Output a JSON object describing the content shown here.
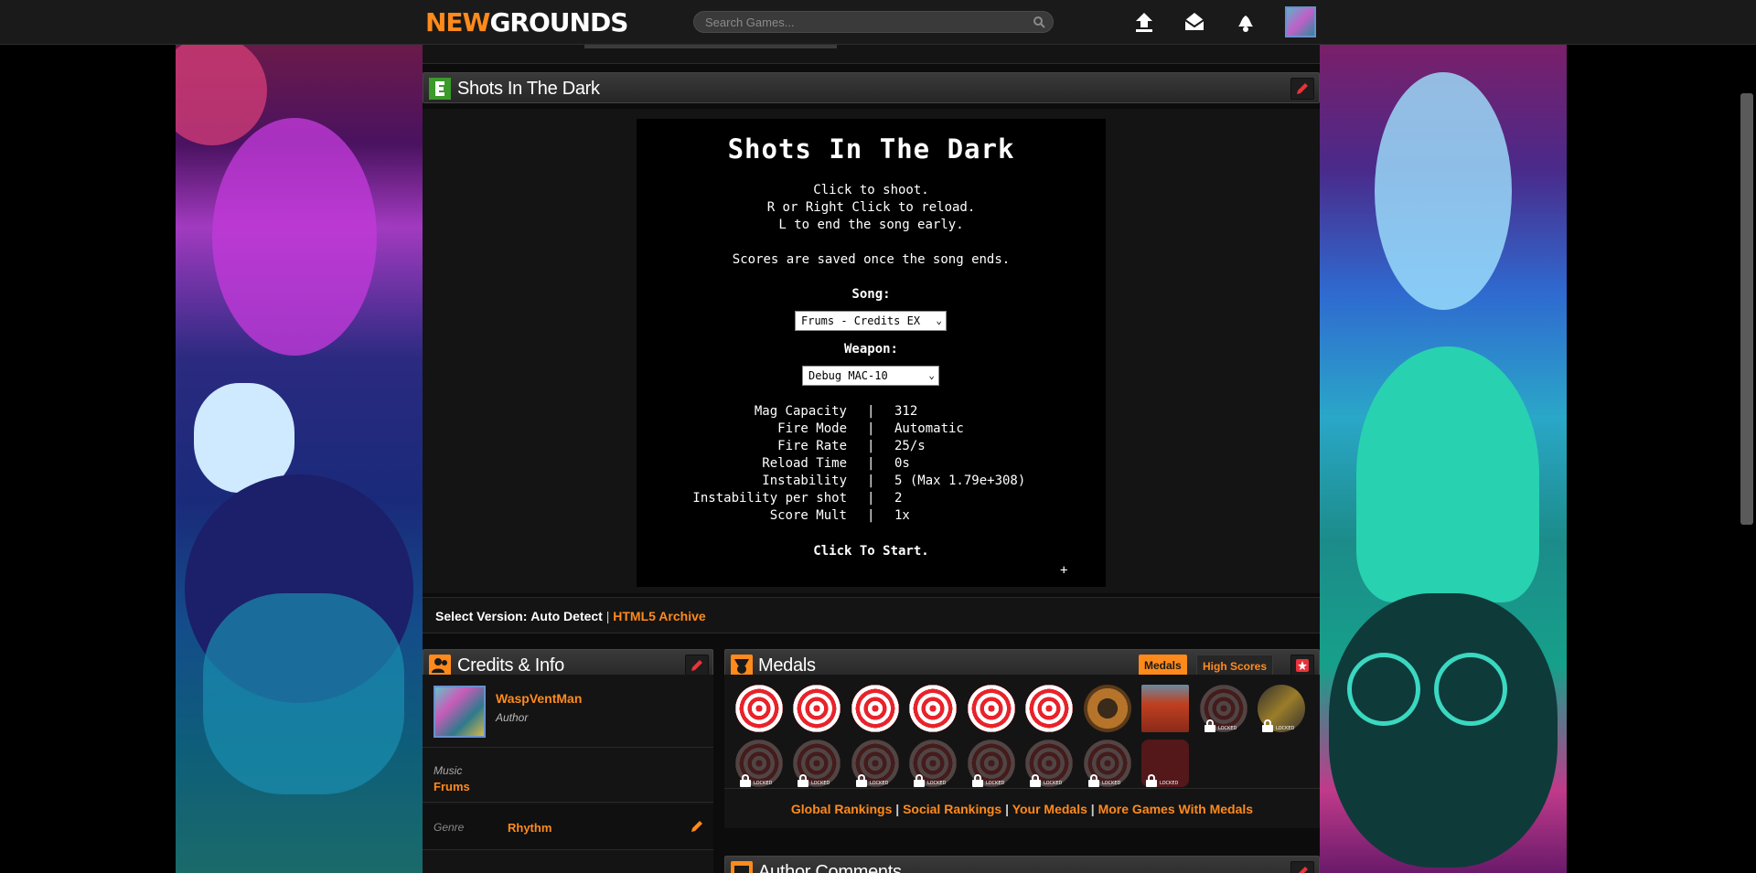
{
  "header": {
    "logo_new": "NEW",
    "logo_grounds": "GROUNDS",
    "search_placeholder": "Search Games..."
  },
  "game_panel": {
    "title": "Shots In The Dark"
  },
  "game": {
    "title": "Shots In The Dark",
    "instructions": [
      "Click to shoot.",
      "R or Right Click to reload.",
      "L to end the song early."
    ],
    "save_note": "Scores are saved once the song ends.",
    "song_label": "Song:",
    "song_value": "Frums - Credits EX",
    "weapon_label": "Weapon:",
    "weapon_value": "Debug MAC-10",
    "stats": [
      {
        "label": "Mag Capacity",
        "sep": "|",
        "value": "312"
      },
      {
        "label": "Fire Mode",
        "sep": "|",
        "value": "Automatic"
      },
      {
        "label": "Fire Rate",
        "sep": "|",
        "value": "25/s"
      },
      {
        "label": "Reload Time",
        "sep": "|",
        "value": "0s"
      },
      {
        "label": "Instability",
        "sep": "|",
        "value": "5 (Max 1.79e+308)"
      },
      {
        "label": "Instability per shot",
        "sep": "|",
        "value": "2"
      },
      {
        "label": "Score Mult",
        "sep": "|",
        "value": "1x"
      }
    ],
    "start": "Click To Start.",
    "crosshair": "+"
  },
  "version": {
    "label": "Select Version:",
    "current": "Auto Detect",
    "sep": "|",
    "archive": "HTML5 Archive"
  },
  "credits": {
    "title": "Credits & Info",
    "author_name": "WaspVentMan",
    "author_role": "Author",
    "music_label": "Music",
    "music_value": "Frums",
    "genre_label": "Genre",
    "genre_value": "Rhythm"
  },
  "medals": {
    "title": "Medals",
    "tab_medals": "Medals",
    "tab_scores": "High Scores",
    "locked_text": "LOCKED",
    "links": [
      "Global Rankings",
      "Social Rankings",
      "Your Medals",
      "More Games With Medals"
    ],
    "link_sep": "|"
  },
  "author_comments": {
    "title": "Author Comments"
  },
  "colors": {
    "accent": "#ff8a1c",
    "header_bg": "#1a1a1a",
    "panel_bg": "#141414"
  }
}
